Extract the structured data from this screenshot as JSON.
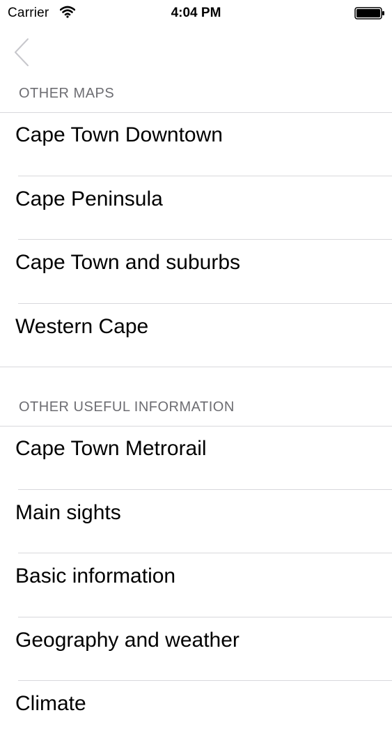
{
  "status_bar": {
    "carrier": "Carrier",
    "time": "4:04 PM",
    "wifi_icon": "wifi-icon",
    "battery_icon": "battery-icon"
  },
  "nav": {
    "back_icon": "chevron-left-icon"
  },
  "sections": [
    {
      "header": "OTHER MAPS",
      "items": [
        {
          "label": "Cape Town Downtown"
        },
        {
          "label": "Cape Peninsula"
        },
        {
          "label": "Cape Town and suburbs"
        },
        {
          "label": "Western Cape"
        }
      ]
    },
    {
      "header": "OTHER USEFUL INFORMATION",
      "items": [
        {
          "label": "Cape Town Metrorail"
        },
        {
          "label": "Main sights"
        },
        {
          "label": "Basic information"
        },
        {
          "label": "Geography and weather"
        },
        {
          "label": "Climate"
        }
      ]
    }
  ],
  "colors": {
    "separator": "#d8d8dc",
    "section_header": "#6d6d72",
    "back_chevron": "#c7c7cc"
  }
}
